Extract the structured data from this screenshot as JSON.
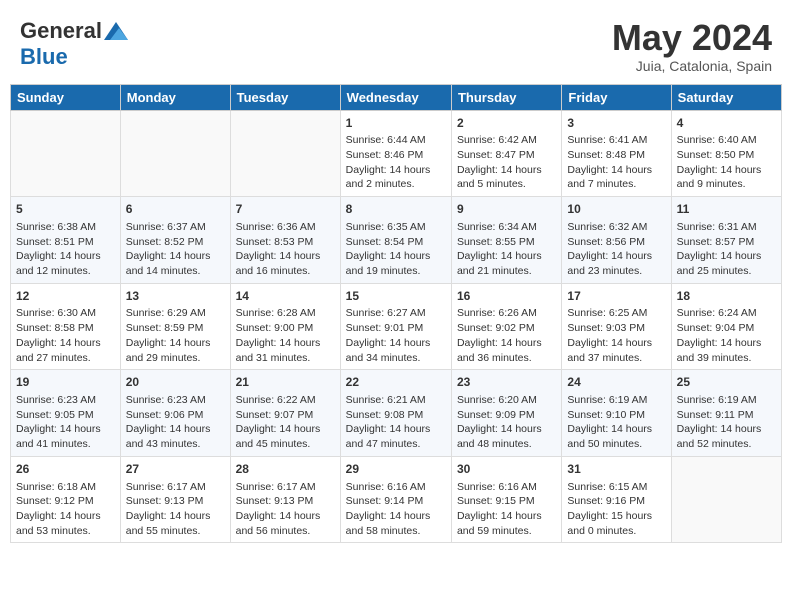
{
  "header": {
    "logo_general": "General",
    "logo_blue": "Blue",
    "month_title": "May 2024",
    "location": "Juia, Catalonia, Spain"
  },
  "weekdays": [
    "Sunday",
    "Monday",
    "Tuesday",
    "Wednesday",
    "Thursday",
    "Friday",
    "Saturday"
  ],
  "weeks": [
    [
      {
        "day": "",
        "info": ""
      },
      {
        "day": "",
        "info": ""
      },
      {
        "day": "",
        "info": ""
      },
      {
        "day": "1",
        "info": "Sunrise: 6:44 AM\nSunset: 8:46 PM\nDaylight: 14 hours\nand 2 minutes."
      },
      {
        "day": "2",
        "info": "Sunrise: 6:42 AM\nSunset: 8:47 PM\nDaylight: 14 hours\nand 5 minutes."
      },
      {
        "day": "3",
        "info": "Sunrise: 6:41 AM\nSunset: 8:48 PM\nDaylight: 14 hours\nand 7 minutes."
      },
      {
        "day": "4",
        "info": "Sunrise: 6:40 AM\nSunset: 8:50 PM\nDaylight: 14 hours\nand 9 minutes."
      }
    ],
    [
      {
        "day": "5",
        "info": "Sunrise: 6:38 AM\nSunset: 8:51 PM\nDaylight: 14 hours\nand 12 minutes."
      },
      {
        "day": "6",
        "info": "Sunrise: 6:37 AM\nSunset: 8:52 PM\nDaylight: 14 hours\nand 14 minutes."
      },
      {
        "day": "7",
        "info": "Sunrise: 6:36 AM\nSunset: 8:53 PM\nDaylight: 14 hours\nand 16 minutes."
      },
      {
        "day": "8",
        "info": "Sunrise: 6:35 AM\nSunset: 8:54 PM\nDaylight: 14 hours\nand 19 minutes."
      },
      {
        "day": "9",
        "info": "Sunrise: 6:34 AM\nSunset: 8:55 PM\nDaylight: 14 hours\nand 21 minutes."
      },
      {
        "day": "10",
        "info": "Sunrise: 6:32 AM\nSunset: 8:56 PM\nDaylight: 14 hours\nand 23 minutes."
      },
      {
        "day": "11",
        "info": "Sunrise: 6:31 AM\nSunset: 8:57 PM\nDaylight: 14 hours\nand 25 minutes."
      }
    ],
    [
      {
        "day": "12",
        "info": "Sunrise: 6:30 AM\nSunset: 8:58 PM\nDaylight: 14 hours\nand 27 minutes."
      },
      {
        "day": "13",
        "info": "Sunrise: 6:29 AM\nSunset: 8:59 PM\nDaylight: 14 hours\nand 29 minutes."
      },
      {
        "day": "14",
        "info": "Sunrise: 6:28 AM\nSunset: 9:00 PM\nDaylight: 14 hours\nand 31 minutes."
      },
      {
        "day": "15",
        "info": "Sunrise: 6:27 AM\nSunset: 9:01 PM\nDaylight: 14 hours\nand 34 minutes."
      },
      {
        "day": "16",
        "info": "Sunrise: 6:26 AM\nSunset: 9:02 PM\nDaylight: 14 hours\nand 36 minutes."
      },
      {
        "day": "17",
        "info": "Sunrise: 6:25 AM\nSunset: 9:03 PM\nDaylight: 14 hours\nand 37 minutes."
      },
      {
        "day": "18",
        "info": "Sunrise: 6:24 AM\nSunset: 9:04 PM\nDaylight: 14 hours\nand 39 minutes."
      }
    ],
    [
      {
        "day": "19",
        "info": "Sunrise: 6:23 AM\nSunset: 9:05 PM\nDaylight: 14 hours\nand 41 minutes."
      },
      {
        "day": "20",
        "info": "Sunrise: 6:23 AM\nSunset: 9:06 PM\nDaylight: 14 hours\nand 43 minutes."
      },
      {
        "day": "21",
        "info": "Sunrise: 6:22 AM\nSunset: 9:07 PM\nDaylight: 14 hours\nand 45 minutes."
      },
      {
        "day": "22",
        "info": "Sunrise: 6:21 AM\nSunset: 9:08 PM\nDaylight: 14 hours\nand 47 minutes."
      },
      {
        "day": "23",
        "info": "Sunrise: 6:20 AM\nSunset: 9:09 PM\nDaylight: 14 hours\nand 48 minutes."
      },
      {
        "day": "24",
        "info": "Sunrise: 6:19 AM\nSunset: 9:10 PM\nDaylight: 14 hours\nand 50 minutes."
      },
      {
        "day": "25",
        "info": "Sunrise: 6:19 AM\nSunset: 9:11 PM\nDaylight: 14 hours\nand 52 minutes."
      }
    ],
    [
      {
        "day": "26",
        "info": "Sunrise: 6:18 AM\nSunset: 9:12 PM\nDaylight: 14 hours\nand 53 minutes."
      },
      {
        "day": "27",
        "info": "Sunrise: 6:17 AM\nSunset: 9:13 PM\nDaylight: 14 hours\nand 55 minutes."
      },
      {
        "day": "28",
        "info": "Sunrise: 6:17 AM\nSunset: 9:13 PM\nDaylight: 14 hours\nand 56 minutes."
      },
      {
        "day": "29",
        "info": "Sunrise: 6:16 AM\nSunset: 9:14 PM\nDaylight: 14 hours\nand 58 minutes."
      },
      {
        "day": "30",
        "info": "Sunrise: 6:16 AM\nSunset: 9:15 PM\nDaylight: 14 hours\nand 59 minutes."
      },
      {
        "day": "31",
        "info": "Sunrise: 6:15 AM\nSunset: 9:16 PM\nDaylight: 15 hours\nand 0 minutes."
      },
      {
        "day": "",
        "info": ""
      }
    ]
  ]
}
